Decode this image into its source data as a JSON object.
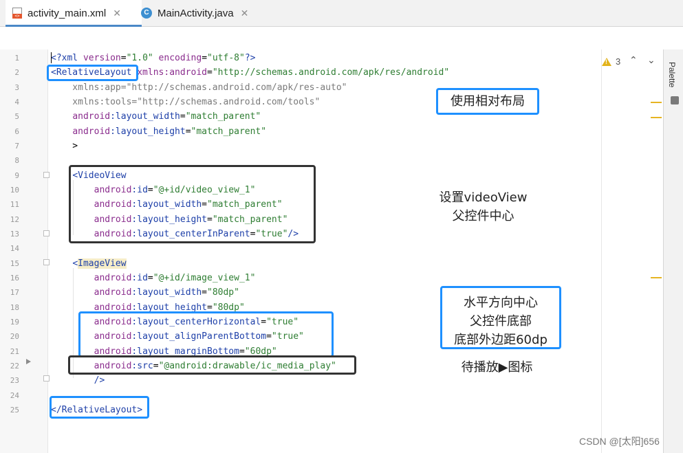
{
  "tabs": [
    {
      "label": "activity_main.xml",
      "close": "✕",
      "icon": "xml-file-icon",
      "active": true
    },
    {
      "label": "MainActivity.java",
      "close": "✕",
      "icon": "java-class-icon",
      "active": false
    }
  ],
  "editor": {
    "line_numbers": [
      "1",
      "2",
      "3",
      "4",
      "5",
      "6",
      "7",
      "8",
      "9",
      "10",
      "11",
      "12",
      "13",
      "14",
      "15",
      "16",
      "17",
      "18",
      "19",
      "20",
      "21",
      "22",
      "23",
      "24",
      "25"
    ],
    "lines": [
      [
        {
          "t": "<?xml ",
          "c": "c-pi"
        },
        {
          "t": "version",
          "c": "c-attr"
        },
        {
          "t": "=",
          "c": ""
        },
        {
          "t": "\"1.0\"",
          "c": "c-val"
        },
        {
          "t": " encoding",
          "c": "c-attr"
        },
        {
          "t": "=",
          "c": ""
        },
        {
          "t": "\"utf-8\"",
          "c": "c-val"
        },
        {
          "t": "?>",
          "c": "c-pi"
        }
      ],
      [
        {
          "t": "<RelativeLayout ",
          "c": "c-tag"
        },
        {
          "t": "xmlns:android",
          "c": "c-attr"
        },
        {
          "t": "=",
          "c": ""
        },
        {
          "t": "\"http://schemas.android.com/apk/res/android\"",
          "c": "c-val"
        }
      ],
      [
        {
          "t": "    xmlns:app=\"http://schemas.android.com/apk/res-auto\"",
          "c": "c-grey"
        }
      ],
      [
        {
          "t": "    xmlns:tools=\"http://schemas.android.com/tools\"",
          "c": "c-grey"
        }
      ],
      [
        {
          "t": "    ",
          "c": ""
        },
        {
          "t": "android",
          "c": "c-attr"
        },
        {
          "t": ":layout_width",
          "c": "c-tag"
        },
        {
          "t": "=",
          "c": ""
        },
        {
          "t": "\"match_parent\"",
          "c": "c-val"
        }
      ],
      [
        {
          "t": "    ",
          "c": ""
        },
        {
          "t": "android",
          "c": "c-attr"
        },
        {
          "t": ":layout_height",
          "c": "c-tag"
        },
        {
          "t": "=",
          "c": ""
        },
        {
          "t": "\"match_parent\"",
          "c": "c-val"
        }
      ],
      [
        {
          "t": "    >",
          "c": ""
        }
      ],
      [
        {
          "t": "",
          "c": ""
        }
      ],
      [
        {
          "t": "    ",
          "c": ""
        },
        {
          "t": "<VideoView",
          "c": "c-tag"
        }
      ],
      [
        {
          "t": "        ",
          "c": ""
        },
        {
          "t": "android",
          "c": "c-attr"
        },
        {
          "t": ":id",
          "c": "c-tag"
        },
        {
          "t": "=",
          "c": ""
        },
        {
          "t": "\"@+id/video_view_1\"",
          "c": "c-val"
        }
      ],
      [
        {
          "t": "        ",
          "c": ""
        },
        {
          "t": "android",
          "c": "c-attr"
        },
        {
          "t": ":layout_width",
          "c": "c-tag"
        },
        {
          "t": "=",
          "c": ""
        },
        {
          "t": "\"match_parent\"",
          "c": "c-val"
        }
      ],
      [
        {
          "t": "        ",
          "c": ""
        },
        {
          "t": "android",
          "c": "c-attr"
        },
        {
          "t": ":layout_height",
          "c": "c-tag"
        },
        {
          "t": "=",
          "c": ""
        },
        {
          "t": "\"match_parent\"",
          "c": "c-val"
        }
      ],
      [
        {
          "t": "        ",
          "c": ""
        },
        {
          "t": "android",
          "c": "c-attr"
        },
        {
          "t": ":layout_centerInParent",
          "c": "c-tag"
        },
        {
          "t": "=",
          "c": ""
        },
        {
          "t": "\"true\"",
          "c": "c-val"
        },
        {
          "t": "/>",
          "c": "c-tag"
        }
      ],
      [
        {
          "t": "",
          "c": ""
        }
      ],
      [
        {
          "t": "    ",
          "c": ""
        },
        {
          "t": "<",
          "c": "c-tag"
        },
        {
          "t": "ImageView",
          "c": "c-tag hl"
        }
      ],
      [
        {
          "t": "        ",
          "c": ""
        },
        {
          "t": "android",
          "c": "c-attr"
        },
        {
          "t": ":id",
          "c": "c-tag"
        },
        {
          "t": "=",
          "c": ""
        },
        {
          "t": "\"@+id/image_view_1\"",
          "c": "c-val"
        }
      ],
      [
        {
          "t": "        ",
          "c": ""
        },
        {
          "t": "android",
          "c": "c-attr"
        },
        {
          "t": ":layout_width",
          "c": "c-tag"
        },
        {
          "t": "=",
          "c": ""
        },
        {
          "t": "\"80dp\"",
          "c": "c-val"
        }
      ],
      [
        {
          "t": "        ",
          "c": ""
        },
        {
          "t": "android",
          "c": "c-attr"
        },
        {
          "t": ":layout_height",
          "c": "c-tag"
        },
        {
          "t": "=",
          "c": ""
        },
        {
          "t": "\"80dp\"",
          "c": "c-val"
        }
      ],
      [
        {
          "t": "        ",
          "c": ""
        },
        {
          "t": "android",
          "c": "c-attr"
        },
        {
          "t": ":layout_centerHorizontal",
          "c": "c-tag"
        },
        {
          "t": "=",
          "c": ""
        },
        {
          "t": "\"true\"",
          "c": "c-val"
        }
      ],
      [
        {
          "t": "        ",
          "c": ""
        },
        {
          "t": "android",
          "c": "c-attr"
        },
        {
          "t": ":layout_alignParentBottom",
          "c": "c-tag"
        },
        {
          "t": "=",
          "c": ""
        },
        {
          "t": "\"true\"",
          "c": "c-val"
        }
      ],
      [
        {
          "t": "        ",
          "c": ""
        },
        {
          "t": "android",
          "c": "c-attr"
        },
        {
          "t": ":layout_marginBottom",
          "c": "c-tag"
        },
        {
          "t": "=",
          "c": ""
        },
        {
          "t": "\"60dp\"",
          "c": "c-val"
        }
      ],
      [
        {
          "t": "        ",
          "c": ""
        },
        {
          "t": "android",
          "c": "c-attr"
        },
        {
          "t": ":src",
          "c": "c-tag"
        },
        {
          "t": "=",
          "c": ""
        },
        {
          "t": "\"@android:drawable/ic_media_play\"",
          "c": "c-val"
        }
      ],
      [
        {
          "t": "        ",
          "c": ""
        },
        {
          "t": "/>",
          "c": "c-tag"
        }
      ],
      [
        {
          "t": "",
          "c": ""
        }
      ],
      [
        {
          "t": "</RelativeLayout>",
          "c": "c-tag"
        }
      ]
    ]
  },
  "inspections": {
    "warning_count": "3",
    "up": "⌃",
    "down": "⌄"
  },
  "side_panel": {
    "label": "Palette"
  },
  "annotations": {
    "relative_layout": "使用相对布局",
    "videoview_line1": "设置videoView",
    "videoview_line2": "父控件中心",
    "image_line1": "水平方向中心",
    "image_line2": "父控件底部",
    "image_line3": "底部外边距60dp",
    "play_icon": "待播放▶图标"
  },
  "watermark": "CSDN @[太阳]656",
  "colors": {
    "annotation_blue": "#1e90ff",
    "annotation_dark": "#333333",
    "tab_underline": "#4a88c7",
    "warning": "#e2b21a"
  }
}
